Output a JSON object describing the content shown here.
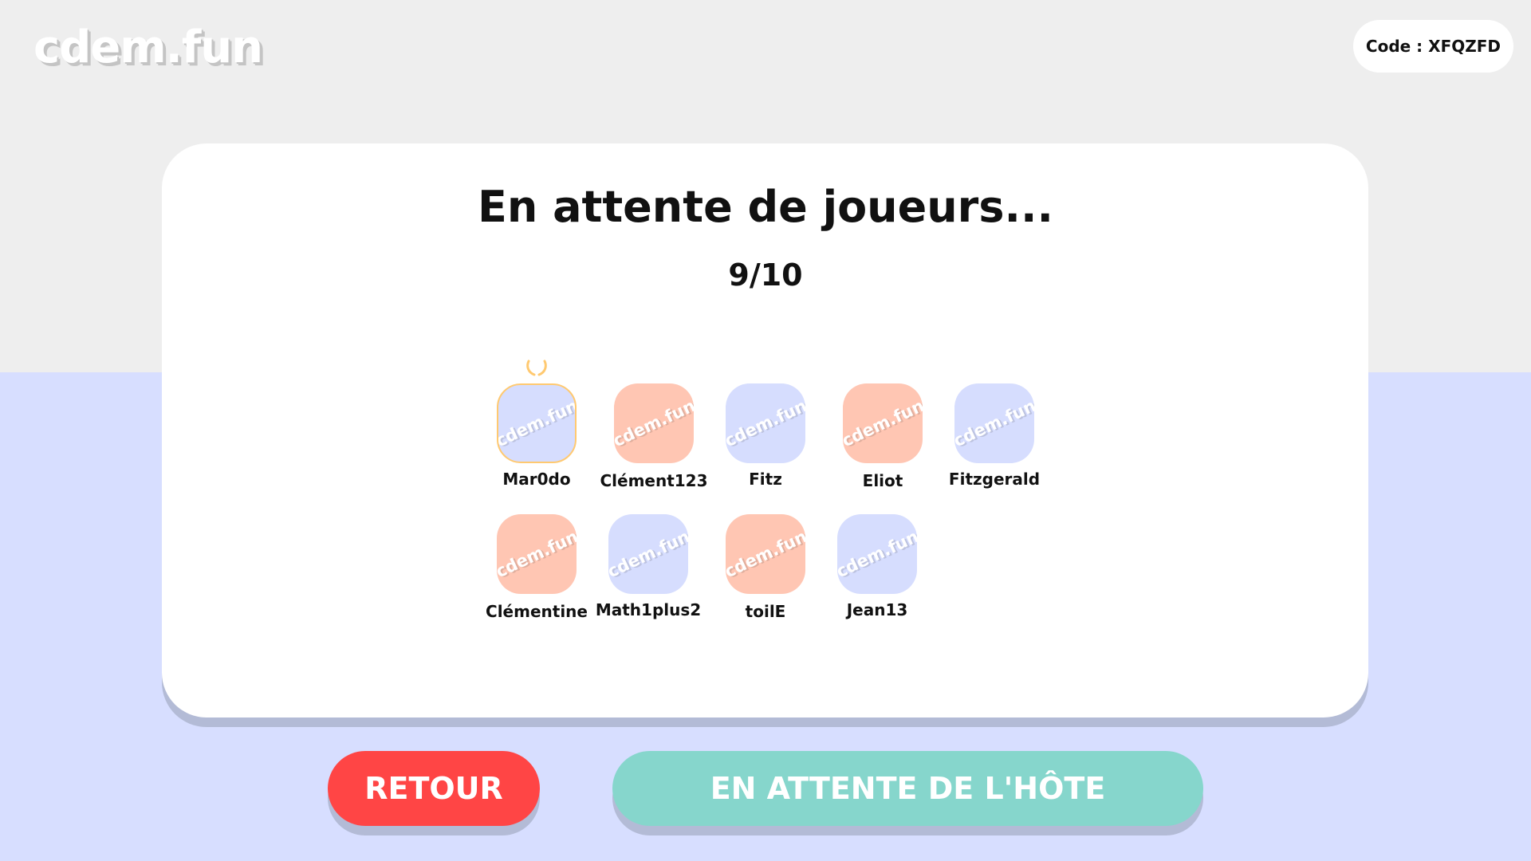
{
  "app": {
    "logo_text": "cdem.fun",
    "code_label": "Code : XFQZFD"
  },
  "lobby": {
    "title": "En attente de  joueurs...",
    "player_count": "9/10",
    "avatar_mark": "cdem.fun"
  },
  "players": [
    {
      "name": "Mar0do",
      "color": "blue",
      "host": true
    },
    {
      "name": "Clément123",
      "color": "peach",
      "host": false
    },
    {
      "name": "Fitz",
      "color": "blue",
      "host": false
    },
    {
      "name": "Eliot",
      "color": "peach",
      "host": false
    },
    {
      "name": "Fitzgerald",
      "color": "blue",
      "host": false
    },
    {
      "name": "Clémentine",
      "color": "peach",
      "host": false
    },
    {
      "name": "Math1plus2",
      "color": "blue",
      "host": false
    },
    {
      "name": "toilE",
      "color": "peach",
      "host": false
    },
    {
      "name": "Jean13",
      "color": "blue",
      "host": false
    }
  ],
  "actions": {
    "back_label": "RETOUR",
    "waiting_label": "EN ATTENTE DE L'HÔTE"
  },
  "colors": {
    "blue_avatar": "#d6ddfe",
    "peach_avatar": "#ffc6b3",
    "back_button": "#ff4545",
    "wait_button": "#86d6cc",
    "band": "#d7deff",
    "crown": "#ffc970"
  }
}
